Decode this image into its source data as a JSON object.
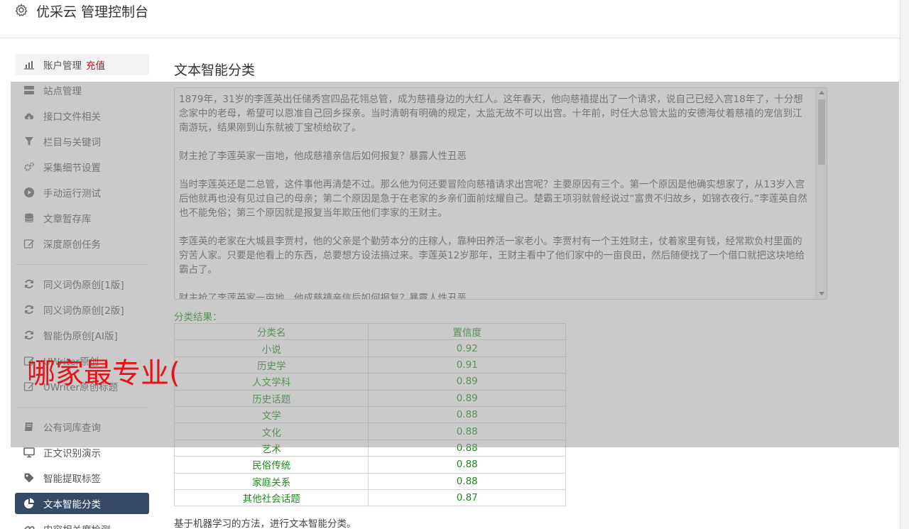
{
  "header": {
    "title": "优采云 管理控制台"
  },
  "sidebar": {
    "items": [
      {
        "label": "账户管理",
        "extra": "充值",
        "icon": "bar-chart-icon"
      },
      {
        "label": "站点管理",
        "icon": "server-icon"
      },
      {
        "label": "接口文件相关",
        "icon": "cloud-download-icon"
      },
      {
        "label": "栏目与关键词",
        "icon": "filter-icon"
      },
      {
        "label": "采集细节设置",
        "icon": "cogs-icon"
      },
      {
        "label": "手动运行测试",
        "icon": "play-circle-icon"
      },
      {
        "label": "文章暂存库",
        "icon": "database-icon"
      },
      {
        "label": "深度原创任务",
        "icon": "edit-icon"
      },
      {
        "label": "同义词伪原创[1版]",
        "icon": "refresh-icon"
      },
      {
        "label": "同义词伪原创[2版]",
        "icon": "refresh-icon"
      },
      {
        "label": "智能伪原创[AI版]",
        "icon": "refresh-icon"
      },
      {
        "label": "UWriter原创",
        "icon": "edit-icon"
      },
      {
        "label": "UWriter原创标题",
        "icon": "edit-icon"
      },
      {
        "label": "公有词库查询",
        "icon": "book-icon"
      },
      {
        "label": "正文识别演示",
        "icon": "monitor-icon"
      },
      {
        "label": "智能提取标签",
        "icon": "tag-icon"
      },
      {
        "label": "文本智能分类",
        "icon": "pie-chart-icon"
      },
      {
        "label": "内容相关度检测",
        "icon": "link-icon"
      }
    ]
  },
  "main": {
    "title": "文本智能分类",
    "text_paragraphs": [
      "1879年，31岁的李莲英出任储秀宫四品花翎总管，成为慈禧身边的大红人。这年春天，他向慈禧提出了一个请求，说自己已经入宫18年了，十分想念家中的老母，希望可以恩准自己回乡探亲。当时清朝有明确的规定，太监无故不可以出宫。十年前，时任大总管太监的安德海仗着慈禧的宠信到江南游玩，结果刚到山东就被丁宝桢给砍了。",
      "财主抢了李莲英家一亩地，他成慈禧亲信后如何报复？暴露人性丑恶",
      "当时李莲英还是二总管，这件事他再清楚不过。那么他为何还要冒险向慈禧请求出宫呢？主要原因有三个。第一个原因是他确实想家了，从13岁入宫后他就再也没有见过自己的母亲；第二个原因是急于在老家的乡亲们面前炫耀自己。楚霸王项羽就曾经说过“富贵不归故乡，如锦衣夜行。”李莲英自然也不能免俗；第三个原因就是报复当年欺压他们李家的王财主。",
      "李莲英的老家在大城县李贾村，他的父亲是个勤劳本分的庄稼人，靠种田养活一家老小。李贾村有一个王姓财主，仗着家里有钱，经常欺负村里面的穷苦人家。只要是他看上的东西，总要想方设法搞过来。李莲英12岁那年，王财主看中了他们家中的一亩良田，然后随便找了一个借口就把这块地给霸占了。",
      "财主抢了李莲英家一亩地，他成慈禧亲信后如何报复？暴露人性丑恶"
    ],
    "result_label": "分类结果：",
    "table": {
      "headers": [
        "分类名",
        "置信度"
      ],
      "rows": [
        [
          "小说",
          "0.92"
        ],
        [
          "历史学",
          "0.91"
        ],
        [
          "人文学科",
          "0.89"
        ],
        [
          "历史话题",
          "0.89"
        ],
        [
          "文学",
          "0.88"
        ],
        [
          "文化",
          "0.88"
        ],
        [
          "艺术",
          "0.88"
        ],
        [
          "民俗传统",
          "0.88"
        ],
        [
          "家庭关系",
          "0.88"
        ],
        [
          "其他社会话题",
          "0.87"
        ]
      ]
    },
    "footnote": "基于机器学习的方法，进行文本智能分类。"
  },
  "watermark": {
    "text": "哪家最专业("
  },
  "colors": {
    "active_nav": "#364a67",
    "recharge": "#d0021b",
    "result_green": "#1e8a1e",
    "watermark": "#e8121a"
  }
}
